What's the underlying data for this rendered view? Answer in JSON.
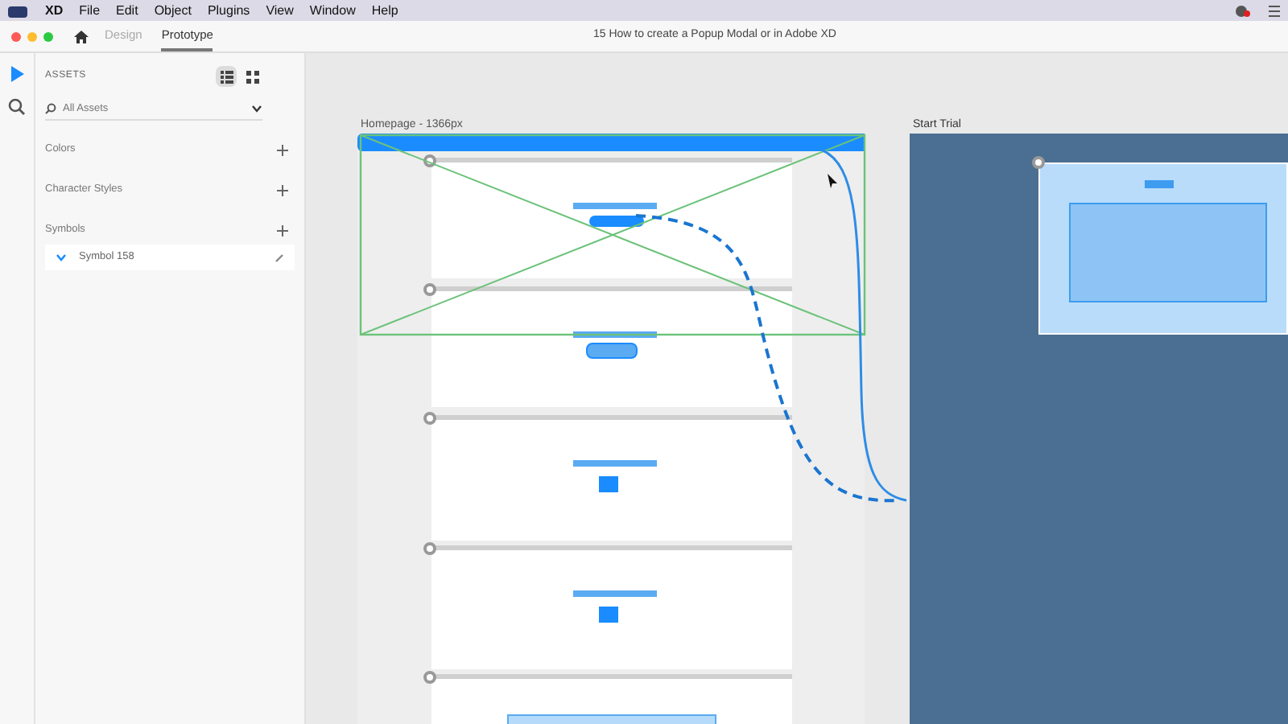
{
  "menu_bar": {
    "app": "XD",
    "items": [
      "File",
      "Edit",
      "Object",
      "Plugins",
      "View",
      "Window",
      "Help"
    ]
  },
  "tabs": [
    {
      "label": "Design",
      "selected": false
    },
    {
      "label": "Prototype",
      "selected": true
    }
  ],
  "document_title": "15 How to create a Popup Modal or in Adobe XD",
  "tools": [
    {
      "kind": "select",
      "selected": true
    },
    {
      "kind": "search",
      "selected": false
    }
  ],
  "assets": {
    "title": "ASSETS",
    "view_modes": [
      {
        "kind": "list",
        "selected": true
      },
      {
        "kind": "grid",
        "selected": false
      }
    ],
    "search": {
      "placeholder": "All Assets"
    },
    "sections": [
      {
        "label": "Colors"
      },
      {
        "label": "Character Styles"
      },
      {
        "label": "Symbols"
      }
    ],
    "symbols": [
      {
        "label": "Symbol 158",
        "expanded": true
      }
    ]
  },
  "canvas": {
    "artboards": [
      {
        "title": "Homepage - 1366px",
        "kind": "page"
      },
      {
        "title": "Start Trial",
        "kind": "overlay"
      }
    ]
  }
}
